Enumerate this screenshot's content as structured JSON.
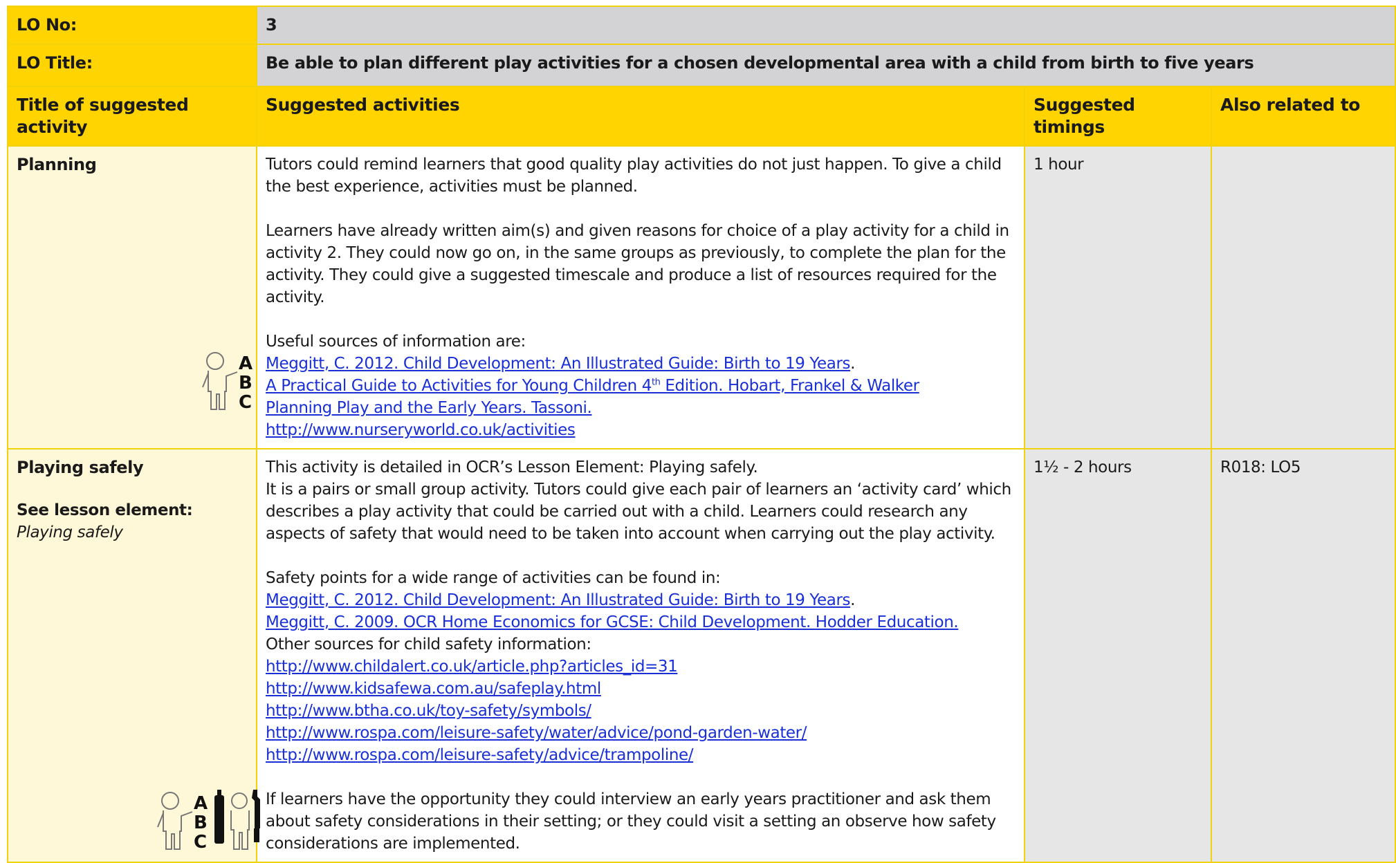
{
  "lo_no": {
    "label": "LO No:",
    "value": "3"
  },
  "lo_title": {
    "label": "LO Title:",
    "value": "Be able to plan different play activities for a chosen developmental area with a child from birth to five years"
  },
  "columns": {
    "title": "Title of suggested activity",
    "activities": "Suggested activities",
    "timings": "Suggested timings",
    "related": "Also related to"
  },
  "rows": [
    {
      "title": "Planning",
      "paragraphs": [
        "Tutors could remind learners that good quality play activities do not just happen. To give a child the best experience, activities must be planned.",
        "Learners have already written aim(s) and given reasons for choice of a play activity for a child in activity 2. They could now go on, in the same groups as previously, to complete the plan for the activity. They could give a suggested timescale and produce a list of resources required for the activity."
      ],
      "sources_intro": "Useful sources of information are:",
      "links": [
        "Meggitt, C.  2012. Child Development: An Illustrated Guide: Birth to 19 Years",
        "A Practical Guide to Activities for Young Children 4",
        "th",
        " Edition. Hobart, Frankel & Walker",
        "Planning Play and the Early Years. Tassoni.",
        "http://www.nurseryworld.co.uk/activities"
      ],
      "link1_suffix": ".",
      "timing": "1 hour",
      "related": "",
      "icons": [
        "abc-teacher-icon"
      ]
    },
    {
      "title": "Playing safely",
      "see_label": "See lesson element:",
      "see_value": "Playing safely",
      "intro_lines": [
        "This activity is detailed in OCR’s Lesson Element: Playing safely.",
        "It is a pairs or small group activity. Tutors could give each pair of learners an ‘activity card’ which describes a play activity that could be carried out with a child. Learners could research any aspects of safety that would need to be taken into account when carrying out the play activity."
      ],
      "safety_intro": "Safety points for a wide range of activities can be found in:",
      "links": [
        "Meggitt, C.  2012. Child Development: An Illustrated Guide: Birth to 19 Years",
        "Meggitt, C. 2009. OCR Home Economics for GCSE: Child Development. Hodder Education."
      ],
      "link1_suffix": ".",
      "other_intro": "Other sources for child safety information:",
      "urls": [
        "http://www.childalert.co.uk/article.php?articles_id=31",
        "http://www.kidsafewa.com.au/safeplay.html",
        "http://www.btha.co.uk/toy-safety/symbols/",
        "http://www.rospa.com/leisure-safety/water/advice/pond-garden-water/",
        "http://www.rospa.com/leisure-safety/advice/trampoline/"
      ],
      "closing": "If learners have the opportunity they could interview an early years practitioner and ask them about safety considerations in their setting; or they could visit a setting an observe how safety considerations are implemented.",
      "timing": "1½ - 2 hours",
      "related": "R018: LO5",
      "icons": [
        "abc-teacher-icon",
        "tools-icon"
      ]
    }
  ],
  "colors": {
    "yellow": "#ffd400",
    "grey": "#d3d3d5",
    "cream": "#fff8d8",
    "link": "#1a2fd6"
  }
}
